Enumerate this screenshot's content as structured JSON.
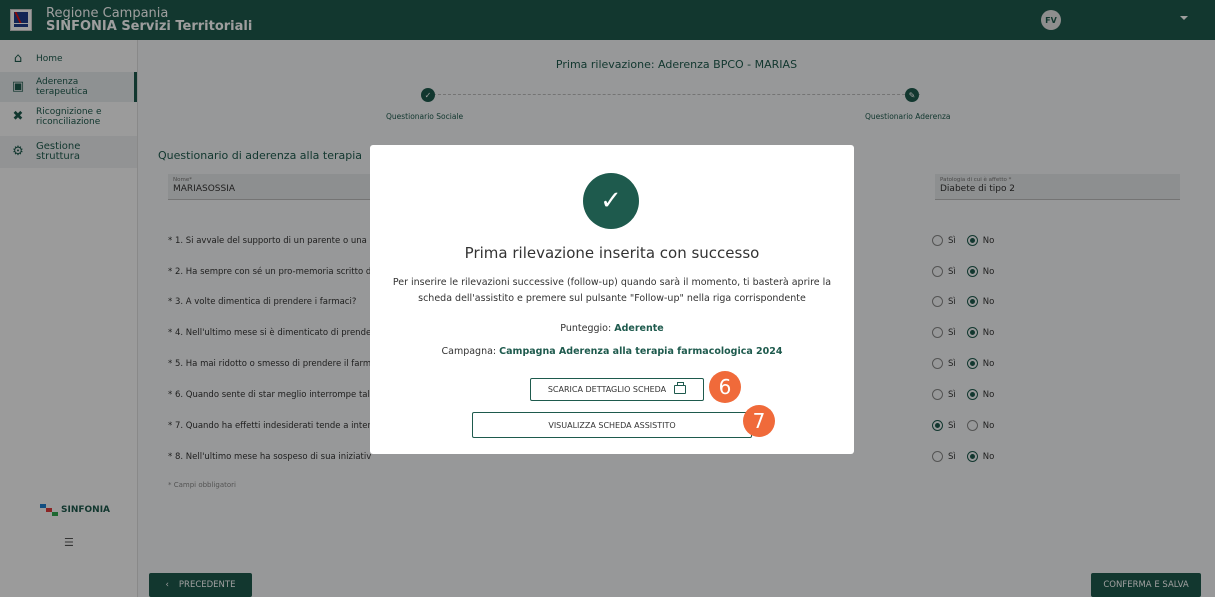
{
  "header": {
    "app_line1": "Regione Campania",
    "app_line2": "SINFONIA Servizi Territoriali",
    "user_initials": "FV"
  },
  "sidebar": {
    "items": [
      {
        "label": "Home",
        "icon": "home-icon"
      },
      {
        "label": "Aderenza terapeutica",
        "icon": "pill-box-icon"
      },
      {
        "label": "Ricognizione e riconciliazione",
        "icon": "bandage-icon"
      },
      {
        "label": "Gestione struttura",
        "icon": "gears-icon"
      }
    ],
    "logo_text": "SINFONIA"
  },
  "main": {
    "title": "Prima rilevazione: Aderenza BPCO -  MARIAS",
    "steps": [
      "Questionario Sociale",
      "Questionario Aderenza"
    ],
    "section_title": "Questionario di aderenza alla terapia",
    "name_field": {
      "label": "Nome*",
      "value": "MARIASOSSIA"
    },
    "disease_field": {
      "label": "Patologia di cui è affetto *",
      "value": "Diabete di tipo 2"
    },
    "questions": [
      {
        "text": "* 1. Si avvale del supporto di un parente o una d",
        "answer": "No"
      },
      {
        "text": "* 2. Ha sempre con sé un pro-memoria scritto d",
        "answer": "No"
      },
      {
        "text": "* 3. A volte dimentica di prendere i farmaci?",
        "answer": "No"
      },
      {
        "text": "* 4. Nell'ultimo mese si è dimenticato di prende",
        "answer": "No"
      },
      {
        "text": "* 5. Ha mai ridotto o smesso di prendere il farm",
        "answer": "No"
      },
      {
        "text": "* 6. Quando sente di star meglio interrompe tal",
        "answer": "No"
      },
      {
        "text": "* 7. Quando ha effetti indesiderati tende a inter",
        "answer": "Sì"
      },
      {
        "text": "* 8. Nell'ultimo mese ha sospeso di sua iniziativ",
        "answer": "No"
      }
    ],
    "yes_label": "Sì",
    "no_label": "No",
    "mandatory_note": "* Campi obbligatori",
    "prev_button": "PRECEDENTE",
    "save_button": "CONFERMA E SALVA"
  },
  "modal": {
    "title": "Prima rilevazione inserita con successo",
    "text": "Per inserire le rilevazioni successive (follow-up) quando sarà il momento, ti basterà aprire la scheda dell'assistito e premere sul pulsante \"Follow-up\" nella riga corrispondente",
    "score_label": "Punteggio:",
    "score_value": "Aderente",
    "campaign_label": "Campagna:",
    "campaign_value": "Campagna Aderenza alla terapia farmacologica 2024",
    "download_button": "SCARICA DETTAGLIO SCHEDA",
    "view_button": "VISUALIZZA SCHEDA ASSISTITO"
  },
  "annotations": {
    "badge1": "6",
    "badge2": "7"
  },
  "colors": {
    "brand": "#1e5a4d",
    "badge": "#f06a3a"
  }
}
